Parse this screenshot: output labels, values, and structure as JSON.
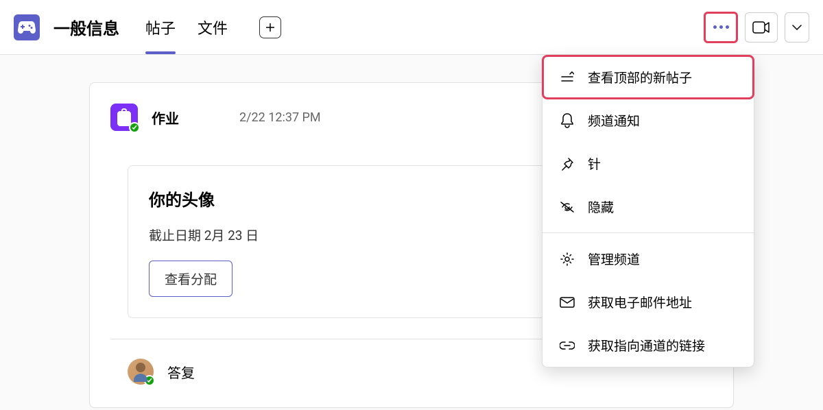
{
  "header": {
    "channel_title": "一般信息",
    "tabs": [
      {
        "label": "帖子",
        "active": true
      },
      {
        "label": "文件",
        "active": false
      }
    ]
  },
  "post": {
    "author": "作业",
    "timestamp": "2/22 12:37 PM",
    "assignment": {
      "title": "你的头像",
      "due_text": "截止日期 2月 23 日",
      "button_label": "查看分配"
    },
    "reply_label": "答复"
  },
  "menu": {
    "items": [
      {
        "icon": "sort-icon",
        "label": "查看顶部的新帖子",
        "highlighted": true
      },
      {
        "icon": "bell-icon",
        "label": "频道通知"
      },
      {
        "icon": "pin-icon",
        "label": "针"
      },
      {
        "icon": "hide-icon",
        "label": "隐藏"
      },
      {
        "divider": true
      },
      {
        "icon": "gear-icon",
        "label": "管理频道"
      },
      {
        "icon": "mail-icon",
        "label": "获取电子邮件地址"
      },
      {
        "icon": "link-icon",
        "label": "获取指向通道的链接"
      }
    ]
  }
}
